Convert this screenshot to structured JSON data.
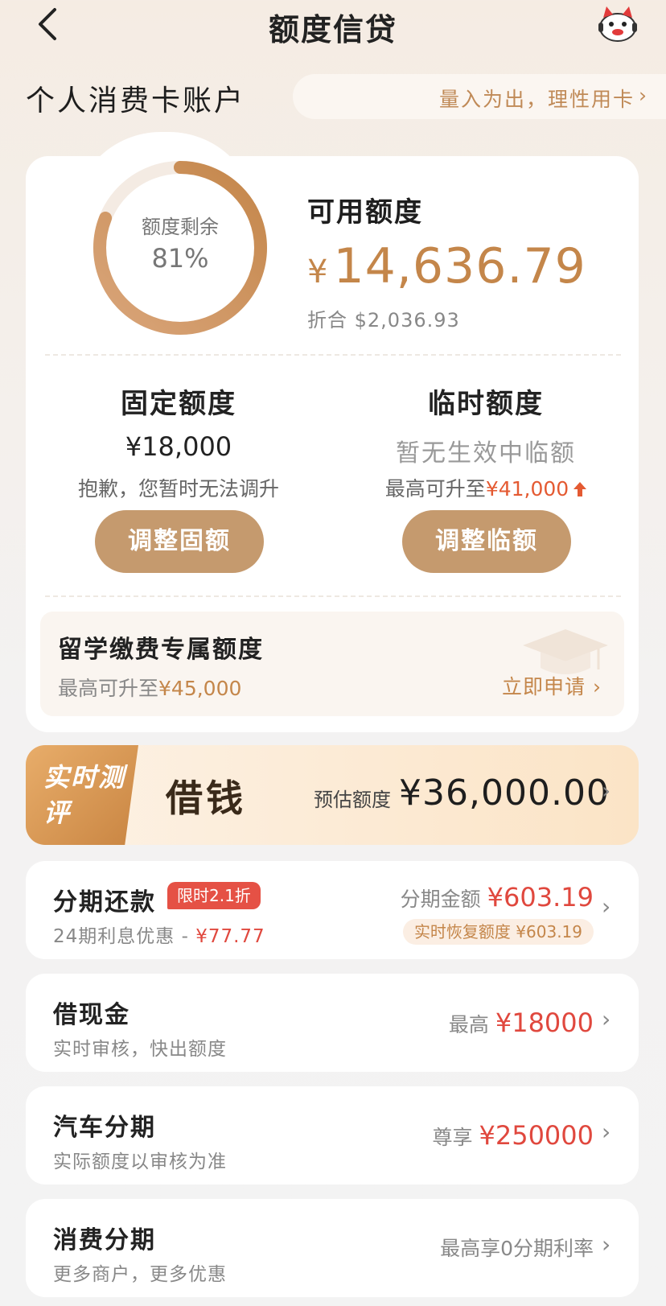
{
  "header": {
    "title": "额度信贷",
    "back_icon": "chevron-left-icon",
    "mascot_icon": "mascot-icon"
  },
  "account": {
    "title": "个人消费卡账户",
    "slogan": "量入为出，理性用卡",
    "slogan_chevron": "›"
  },
  "credit": {
    "ring_label": "额度剩余",
    "ring_percent": "81%",
    "ring_fraction": 0.81,
    "available_label": "可用额度",
    "available_currency": "¥",
    "available_amount": "14,636.79",
    "usd_equivalent": "折合 $2,036.93",
    "fixed": {
      "title": "固定额度",
      "value": "¥18,000",
      "note": "抱歉，您暂时无法调升",
      "button": "调整固额"
    },
    "temporary": {
      "title": "临时额度",
      "value": "暂无生效中临额",
      "note_prefix": "最高可升至",
      "note_amount": "¥41,000",
      "button": "调整临额"
    },
    "study": {
      "title": "留学缴费专属额度",
      "note_prefix": "最高可升至",
      "note_amount": "¥45,000",
      "link": "立即申请 ›"
    }
  },
  "borrow": {
    "tag": "实时测评",
    "title": "借钱",
    "estimate_label": "预估额度",
    "estimate_amount": "¥36,000.00",
    "chevron": "›"
  },
  "list": [
    {
      "title": "分期还款",
      "badge": "限时2.1折",
      "sub_prefix": "24期利息优惠 - ",
      "sub_amount": "¥77.77",
      "right_label": "分期金额",
      "right_amount": "¥603.19",
      "pill": "实时恢复额度 ¥603.19"
    },
    {
      "title": "借现金",
      "sub": "实时审核，快出额度",
      "right_label": "最高",
      "right_amount": "¥18000"
    },
    {
      "title": "汽车分期",
      "sub": "实际额度以审核为准",
      "right_label": "尊享",
      "right_amount": "¥250000"
    },
    {
      "title": "消费分期",
      "sub": "更多商户，更多优惠",
      "right_label": "最高享0分期利率"
    }
  ],
  "colors": {
    "accent_gold": "#c4864a",
    "button_gold": "#c59a6e",
    "alert_red": "#e0483e"
  }
}
